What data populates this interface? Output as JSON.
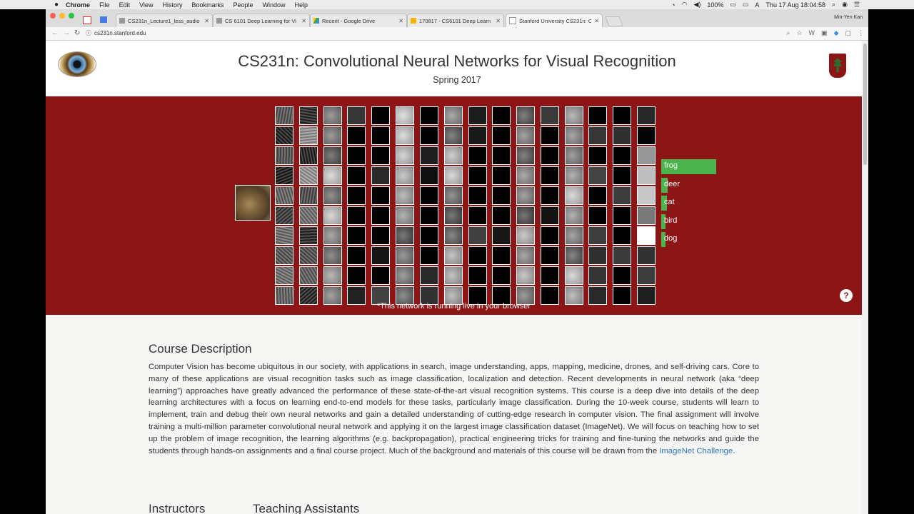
{
  "menubar": {
    "app": "Chrome",
    "items": [
      "File",
      "Edit",
      "View",
      "History",
      "Bookmarks",
      "People",
      "Window",
      "Help"
    ],
    "battery": "100%",
    "clock": "Thu 17 Aug  18:04:58"
  },
  "tabs": [
    {
      "title": "CS231n_Lecture1_less_audio",
      "active": false
    },
    {
      "title": "CS 6101 Deep Learning for Vi",
      "active": false
    },
    {
      "title": "Recent - Google Drive",
      "active": false
    },
    {
      "title": "170817 - CS6101 Deep Learn",
      "active": false
    },
    {
      "title": "Stanford University CS231n: C",
      "active": true
    }
  ],
  "profile": "Min-Yen Kan",
  "toolbar": {
    "url": "cs231n.stanford.edu"
  },
  "page": {
    "title": "CS231n: Convolutional Neural Networks for Visual Recognition",
    "subtitle": "Spring 2017",
    "caption": "*This network is running live in your browser",
    "help": "?"
  },
  "predictions": [
    {
      "label": "frog",
      "prob": 1.0
    },
    {
      "label": "deer",
      "prob": 0.12
    },
    {
      "label": "cat",
      "prob": 0.1
    },
    {
      "label": "bird",
      "prob": 0.08
    },
    {
      "label": "dog",
      "prob": 0.07
    }
  ],
  "description": {
    "heading": "Course Description",
    "text": "Computer Vision has become ubiquitous in our society, with applications in search, image understanding, apps, mapping, medicine, drones, and self-driving cars. Core to many of these applications are visual recognition tasks such as image classification, localization and detection. Recent developments in neural network (aka “deep learning”) approaches have greatly advanced the performance of these state-of-the-art visual recognition systems. This course is a deep dive into details of the deep learning architectures with a focus on learning end-to-end models for these tasks, particularly image classification. During the 10-week course, students will learn to implement, train and debug their own neural networks and gain a detailed understanding of cutting-edge research in computer vision. The final assignment will involve training a multi-million parameter convolutional neural network and applying it on the largest image classification dataset (ImageNet). We will focus on teaching how to set up the problem of image recognition, the learning algorithms (e.g. backpropagation), practical engineering tricks for training and fine-tuning the networks and guide the students through hands-on assignments and a final course project. Much of the background and materials of this course will be drawn from the ",
    "link": "ImageNet Challenge",
    "tail": "."
  },
  "sections": {
    "instructors": "Instructors",
    "tas": "Teaching Assistants"
  },
  "colors": {
    "cardinal": "#8c1515",
    "bar": "#4cb44c",
    "link": "#2f78b6"
  }
}
